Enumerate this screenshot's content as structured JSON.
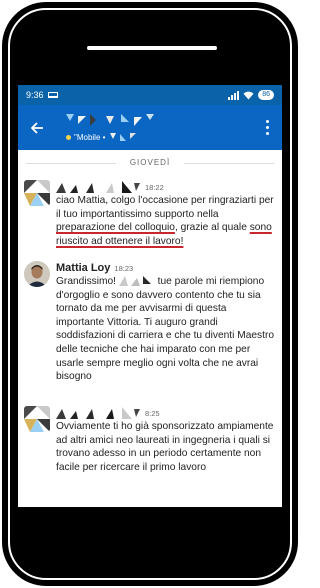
{
  "status_bar": {
    "time": "9:36",
    "battery": "86"
  },
  "header": {
    "subtitle": "\"Mobile •"
  },
  "day_divider": "GIOVEDÌ",
  "messages": [
    {
      "time": "18:22",
      "text_a": "ciao Mattia, colgo l'occasione per ringraziarti per il tuo importantissimo supporto nella ",
      "text_u1": "preparazione del colloquio",
      "text_b": ", grazie al quale ",
      "text_u2": "sono riuscito ad ottenere il lavoro!"
    },
    {
      "sender": "Mattia Loy",
      "time": "18:23",
      "text_a": "Grandissimo! ",
      "text_b": " tue parole mi riempiono d'orgoglio e sono davvero contento che tu sia tornato da me per avvisarmi di questa importante Vittoria. Ti auguro grandi soddisfazioni di carriera e che tu diventi Maestro delle tecniche che hai imparato con me per usarle sempre meglio ogni volta che ne avrai bisogno"
    },
    {
      "time": "8:25",
      "text": "Ovviamente ti ho già sponsorizzato ampiamente ad altri amici neo laureati in ingegneria i quali si trovano adesso in un periodo certamente non facile per ricercare il primo lavoro"
    }
  ],
  "colors": {
    "status_bar": "#0a63a8",
    "app_bar": "#0a66c2",
    "underline": "#c7282d"
  },
  "icons": [
    "laptop-icon",
    "signal-icon",
    "wifi-icon",
    "battery-icon",
    "back-arrow-icon",
    "more-vert-icon"
  ]
}
